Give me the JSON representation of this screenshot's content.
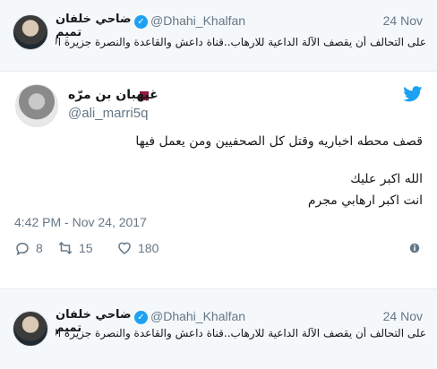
{
  "quoted_top": {
    "display_name": "ضاحي خلفان تميم",
    "handle": "@Dhahi_Khalfan",
    "date": "24 Nov",
    "text": "على التحالف أن يقصف الآلة الداعية للارهاب..قناة داعش والقاعدة والنصرة جزيرة الارهاب"
  },
  "tweet": {
    "display_name": "غيهبان بن مرّه",
    "handle": "@ali_marri5q",
    "line1": "قصف محطه اخباريه وقتل كل الصحفيين ومن يعمل فيها",
    "line2": "الله اكبر عليك",
    "line3": "انت اكبر ارهابي مجرم",
    "timestamp": "4:42 PM - Nov 24, 2017",
    "reply_count": "8",
    "retweet_count": "15",
    "like_count": "180"
  },
  "quoted_bottom": {
    "display_name": "ضاحي خلفان تميم",
    "handle": "@Dhahi_Khalfan",
    "date": "24 Nov",
    "text": "على التحالف أن يقصف الآلة الداعية للارهاب..قناة داعش والقاعدة والنصرة جزيرة الارهاب"
  },
  "colors": {
    "twitter_blue": "#1da1f2",
    "muted": "#657786",
    "text": "#14171a",
    "quoted_bg": "#f5f8fa"
  },
  "icons": {
    "verified": "verified-badge-icon",
    "bird": "twitter-bird-icon",
    "reply": "reply-icon",
    "retweet": "retweet-icon",
    "like": "heart-icon",
    "info": "info-icon",
    "flag": "qatar-flag-icon"
  }
}
